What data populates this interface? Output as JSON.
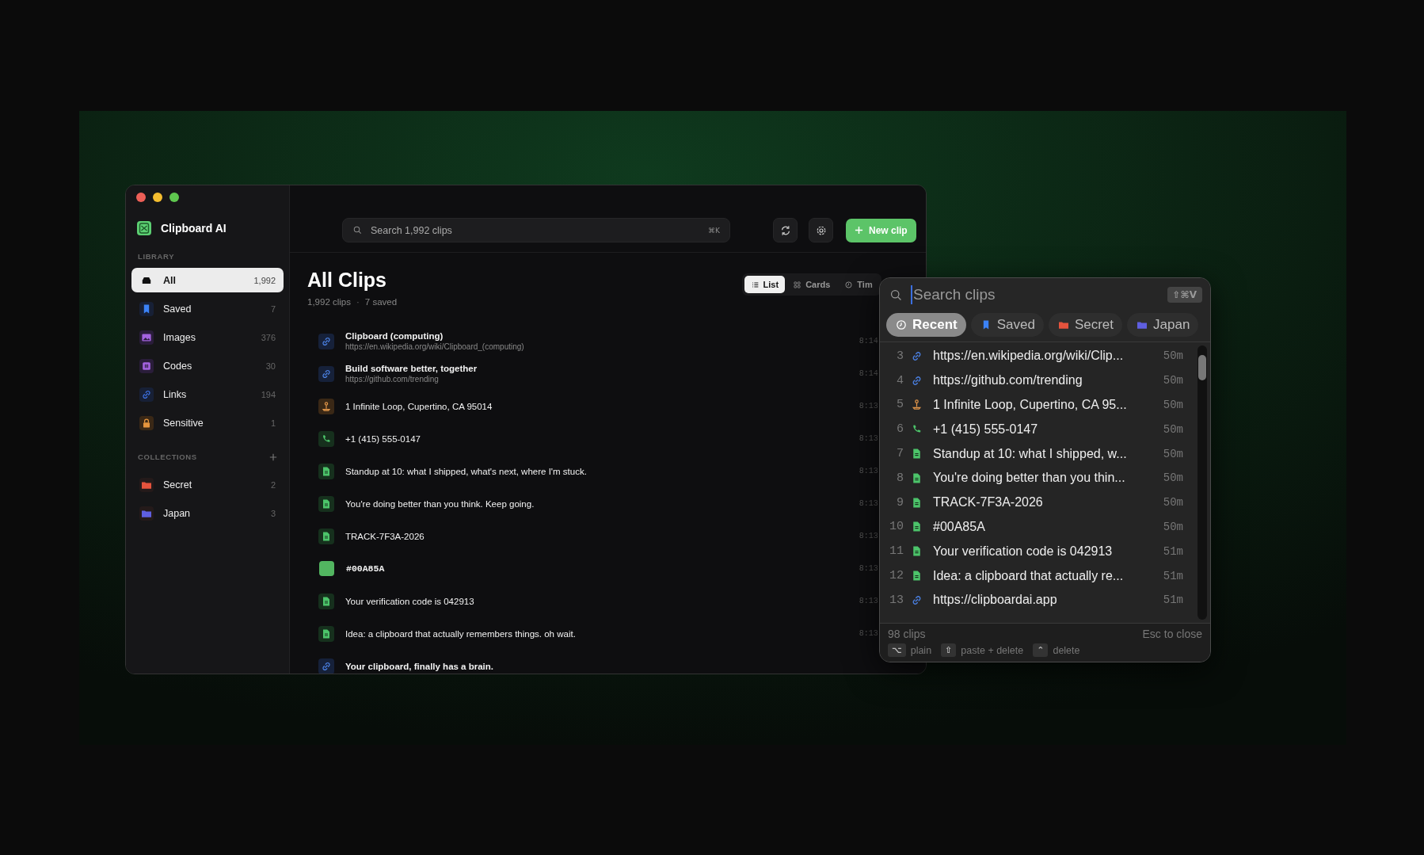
{
  "main_window": {
    "sidebar": {
      "app_name": "Clipboard AI",
      "library_heading": "LIBRARY",
      "library": [
        {
          "label": "All",
          "count": "1,992",
          "selected": true
        },
        {
          "label": "Saved",
          "count": "7",
          "selected": false
        },
        {
          "label": "Images",
          "count": "376",
          "selected": false
        },
        {
          "label": "Codes",
          "count": "30",
          "selected": false
        },
        {
          "label": "Links",
          "count": "194",
          "selected": false
        },
        {
          "label": "Sensitive",
          "count": "1",
          "selected": false
        }
      ],
      "collections_heading": "COLLECTIONS",
      "collections": [
        {
          "label": "Secret",
          "count": "2",
          "color": "#e5533d",
          "selected": false
        },
        {
          "label": "Japan",
          "count": "3",
          "color": "#5f5fe0",
          "selected": false
        }
      ]
    },
    "toolbar": {
      "search": {
        "placeholder": "Search 1,992 clips",
        "shortcut": "⌘K"
      },
      "new_clip_button": "New clip"
    },
    "header": {
      "title": "All Clips",
      "clip_count": "1,992 clips",
      "separator": "·",
      "saved_count": "7 saved"
    },
    "view_tabs": [
      {
        "label": "List",
        "selected": true
      },
      {
        "label": "Cards",
        "selected": false
      },
      {
        "label": "Tim",
        "selected": false
      }
    ],
    "clips": [
      {
        "kind": "link",
        "title": "Clipboard (computing)",
        "url": "https://en.wikipedia.org/wiki/Clipboard_(computing)",
        "time": "8:14"
      },
      {
        "kind": "link",
        "title": "Build software better, together",
        "url": "https://github.com/trending",
        "time": "8:14"
      },
      {
        "kind": "location",
        "title": "1 Infinite Loop, Cupertino, CA 95014",
        "time": "8:13"
      },
      {
        "kind": "phone",
        "title": "+1 (415) 555-0147",
        "time": "8:13"
      },
      {
        "kind": "note",
        "title": "Standup at 10: what I shipped, what's next, where I'm stuck.",
        "time": "8:13"
      },
      {
        "kind": "note",
        "title": "You're doing better than you think. Keep going.",
        "time": "8:13"
      },
      {
        "kind": "note",
        "title": "TRACK-7F3A-2026",
        "time": "8:13"
      },
      {
        "kind": "color",
        "title": "#00A85A",
        "color": "#52b560",
        "time": "8:13"
      },
      {
        "kind": "note",
        "title": "Your verification code is 042913",
        "time": "8:13"
      },
      {
        "kind": "note",
        "title": "Idea: a clipboard that actually remembers things. oh wait.",
        "time": "8:13"
      },
      {
        "kind": "link",
        "title": "Your clipboard, finally has a brain."
      }
    ]
  },
  "popup": {
    "search": {
      "placeholder": "Search clips",
      "shortcut": "⇧⌘V"
    },
    "filters": [
      {
        "label": "Recent",
        "selected": true
      },
      {
        "label": "Saved",
        "selected": false
      },
      {
        "label": "Secret",
        "color": "#e5533d",
        "selected": false
      },
      {
        "label": "Japan",
        "color": "#5f5fe0",
        "selected": false
      }
    ],
    "rows": [
      {
        "index": "3",
        "kind": "link",
        "text": "https://en.wikipedia.org/wiki/Clip...",
        "age": "50m"
      },
      {
        "index": "4",
        "kind": "link",
        "text": "https://github.com/trending",
        "age": "50m"
      },
      {
        "index": "5",
        "kind": "location",
        "text": "1 Infinite Loop, Cupertino, CA 95...",
        "age": "50m"
      },
      {
        "index": "6",
        "kind": "phone",
        "text": "+1 (415) 555-0147",
        "age": "50m"
      },
      {
        "index": "7",
        "kind": "note",
        "text": "Standup at 10: what I shipped, w...",
        "age": "50m"
      },
      {
        "index": "8",
        "kind": "note",
        "text": "You're doing better than you thin...",
        "age": "50m"
      },
      {
        "index": "9",
        "kind": "note",
        "text": "TRACK-7F3A-2026",
        "age": "50m"
      },
      {
        "index": "10",
        "kind": "note",
        "text": "#00A85A",
        "age": "50m"
      },
      {
        "index": "11",
        "kind": "note",
        "text": "Your verification code is 042913",
        "age": "51m"
      },
      {
        "index": "12",
        "kind": "note",
        "text": "Idea: a clipboard that actually re...",
        "age": "51m"
      },
      {
        "index": "13",
        "kind": "link",
        "text": "https://clipboardai.app",
        "age": "51m"
      }
    ],
    "footer": {
      "count": "98 clips",
      "hint": "Esc to close",
      "keys": [
        {
          "key": "⌥",
          "label": "plain"
        },
        {
          "key": "⇧",
          "label": "paste + delete"
        },
        {
          "key": "⌃",
          "label": "delete"
        }
      ]
    }
  }
}
